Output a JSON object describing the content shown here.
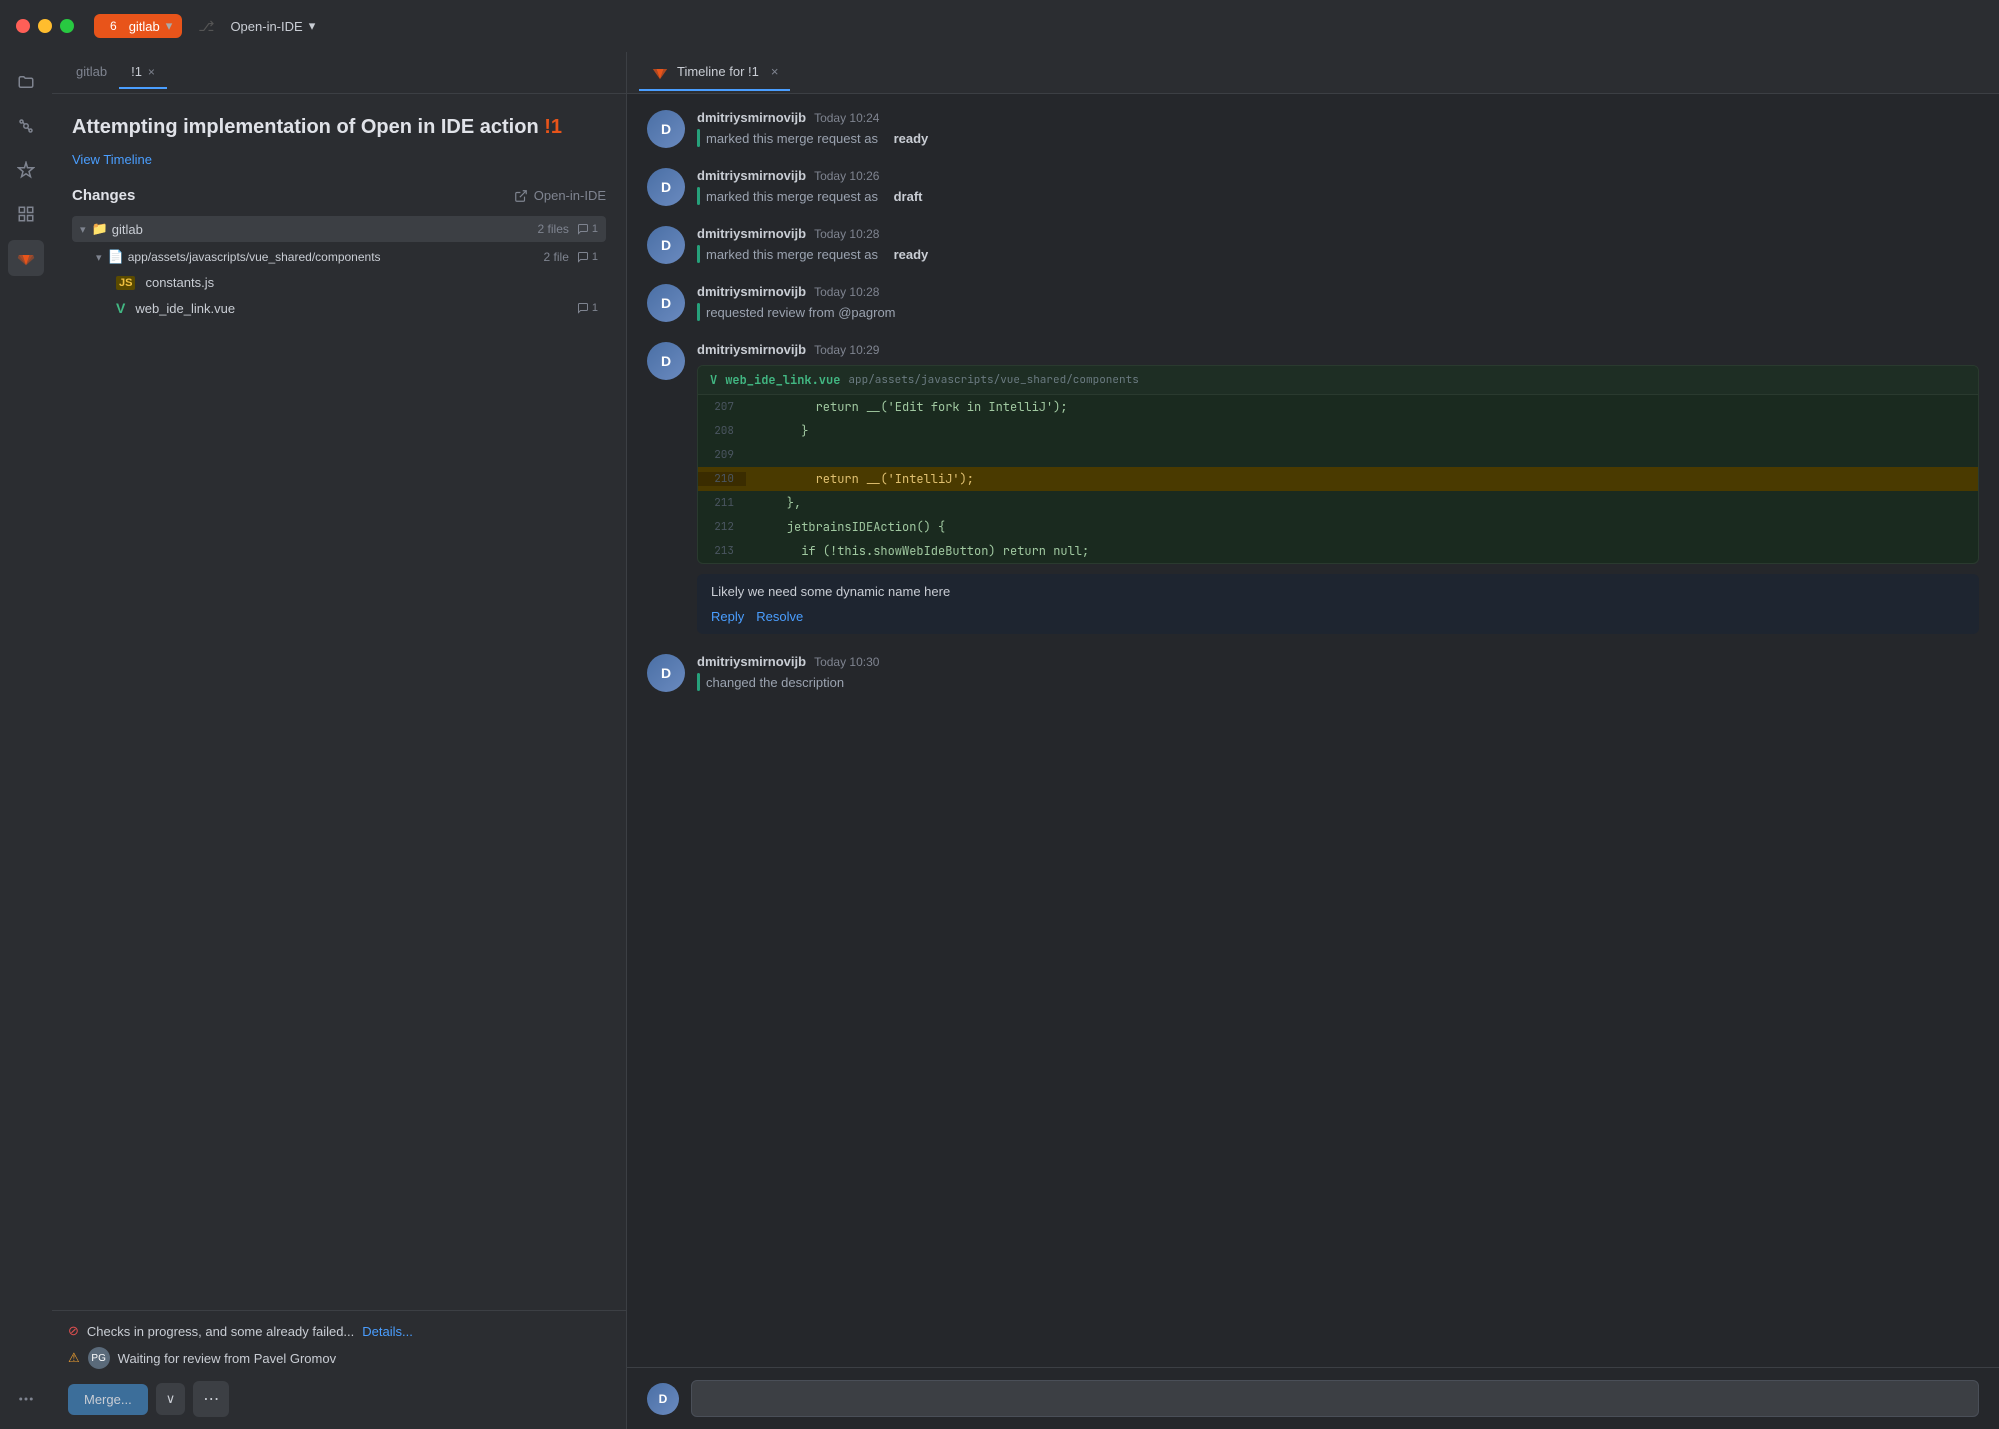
{
  "titlebar": {
    "app_name": "gitlab",
    "tab_number": "6",
    "tab_label": "gitlab",
    "mr_tab": "!1",
    "close_label": "×",
    "open_in_ide": "Open-in-IDE",
    "dropdown_arrow": "⌄"
  },
  "left_panel": {
    "tab_label": "gitlab",
    "tab_mr": "!1",
    "mr_title": "Attempting implementation of Open in IDE action",
    "mr_id": "!1",
    "view_timeline": "View Timeline",
    "changes_label": "Changes",
    "open_in_ide_label": "Open-in-IDE",
    "file_tree": {
      "root_label": "gitlab",
      "root_file_count": "2 files",
      "root_comment_count": "1",
      "folder_label": "app/assets/javascripts/vue_shared/components",
      "folder_file_count": "2 file",
      "folder_comment_count": "1",
      "files": [
        {
          "name": "constants.js",
          "type": "js",
          "badge": "JS",
          "comment_count": ""
        },
        {
          "name": "web_ide_link.vue",
          "type": "vue",
          "badge": "V",
          "comment_count": "1"
        }
      ]
    },
    "footer": {
      "checks_text": "Checks in progress, and some already failed...",
      "details_label": "Details...",
      "waiting_label": "Waiting for review from Pavel Gromov"
    },
    "merge_button": "Merge...",
    "dropdown_arrow": "∨",
    "more_dots": "⋯"
  },
  "right_panel": {
    "tab_label": "Timeline for !1",
    "close_label": "×",
    "events": [
      {
        "author": "dmitriysmirnovijb",
        "time": "Today 10:24",
        "text": "marked this merge request as",
        "status": "ready",
        "avatar_initials": "D"
      },
      {
        "author": "dmitriysmirnovijb",
        "time": "Today 10:26",
        "text": "marked this merge request as",
        "status": "draft",
        "avatar_initials": "D"
      },
      {
        "author": "dmitriysmirnovijb",
        "time": "Today 10:28",
        "text": "marked this merge request as",
        "status": "ready",
        "avatar_initials": "D"
      },
      {
        "author": "dmitriysmirnovijb",
        "time": "Today 10:28",
        "text": "requested review from @pagrom",
        "status": "",
        "avatar_initials": "D"
      }
    ],
    "code_event": {
      "author": "dmitriysmirnovijb",
      "time": "Today 10:29",
      "avatar_initials": "D",
      "file_name": "web_ide_link.vue",
      "file_path": "app/assets/javascripts/vue_shared/components",
      "code_lines": [
        {
          "num": "207",
          "content": "        return __('Edit fork in IntelliJ');",
          "highlighted": false
        },
        {
          "num": "208",
          "content": "      }",
          "highlighted": false
        },
        {
          "num": "209",
          "content": "",
          "highlighted": false
        },
        {
          "num": "210",
          "content": "        return __('IntelliJ');",
          "highlighted": true
        },
        {
          "num": "211",
          "content": "    },",
          "highlighted": false
        },
        {
          "num": "212",
          "content": "    jetbrainsIDEAction() {",
          "highlighted": false
        },
        {
          "num": "213",
          "content": "      if (!this.showWebIdeButton) return null;",
          "highlighted": false
        }
      ],
      "comment": "Likely we need some dynamic name here",
      "reply_label": "Reply",
      "resolve_label": "Resolve"
    },
    "last_event": {
      "author": "dmitriysmirnovijb",
      "time": "Today 10:30",
      "text": "changed the description",
      "avatar_initials": "D"
    },
    "reply_placeholder": ""
  }
}
